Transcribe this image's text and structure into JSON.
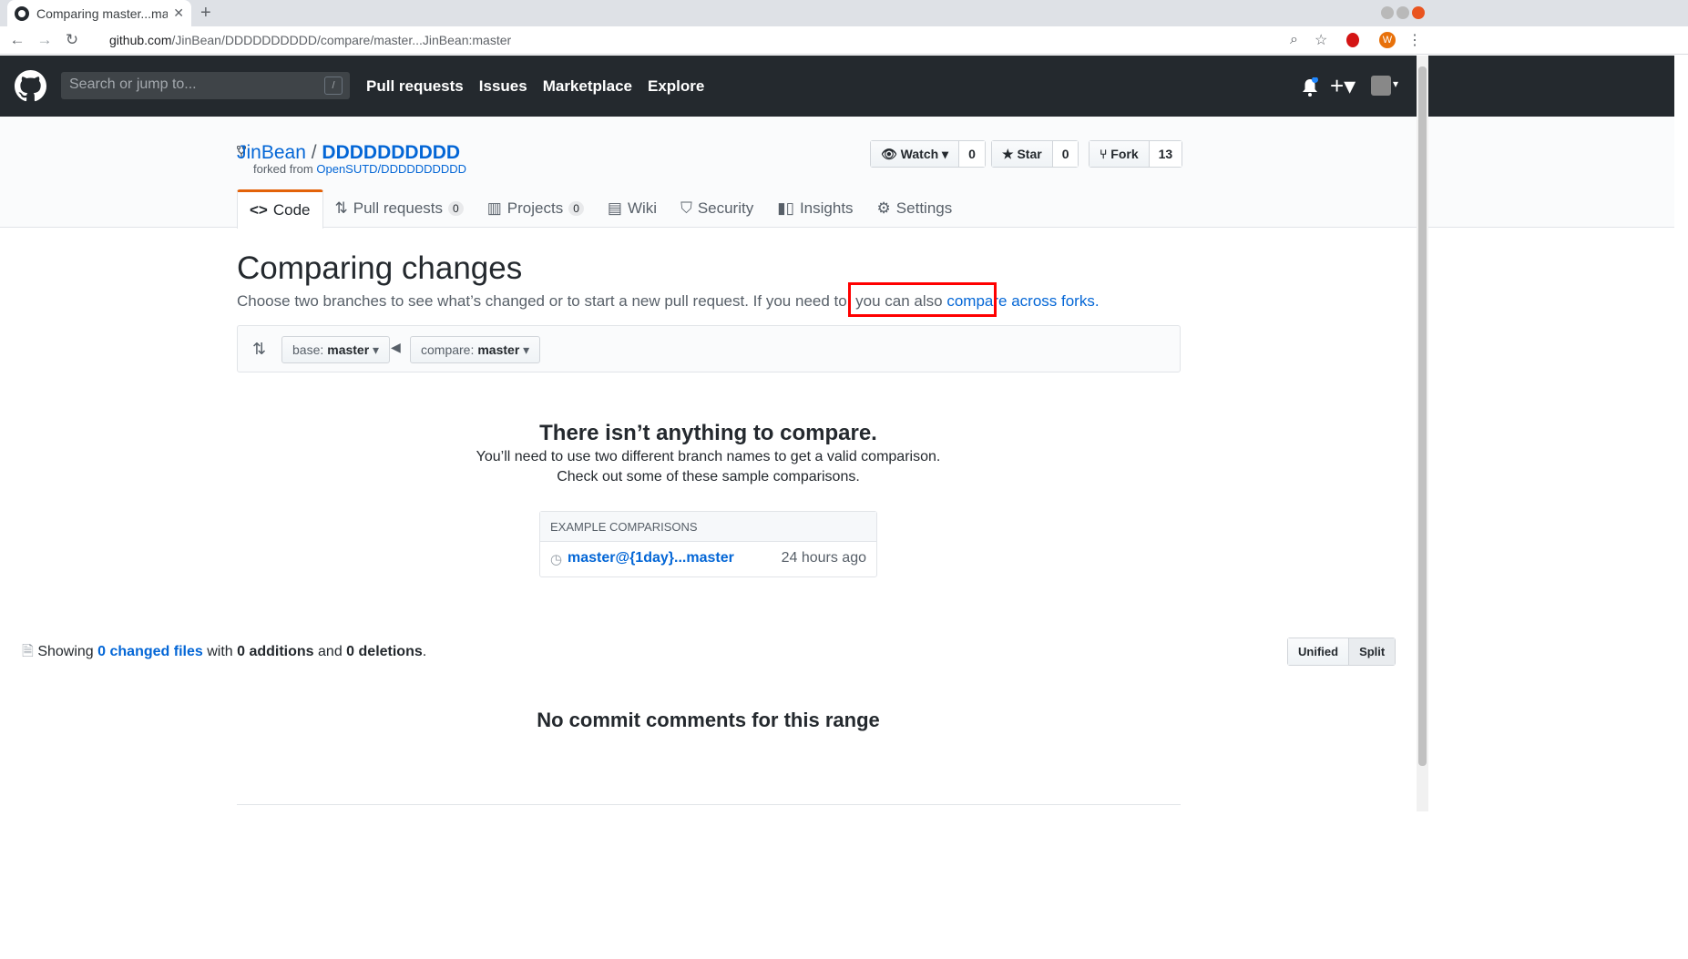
{
  "browser": {
    "tab_title": "Comparing master...mast",
    "url_host": "github.com",
    "url_path": "/JinBean/DDDDDDDDDD/compare/master...JinBean:master",
    "profile_initial": "W"
  },
  "header": {
    "search_placeholder": "Search or jump to...",
    "search_key": "/",
    "nav": [
      "Pull requests",
      "Issues",
      "Marketplace",
      "Explore"
    ]
  },
  "repo": {
    "owner": "JinBean",
    "separator": "/",
    "name": "DDDDDDDDDD",
    "forked_prefix": "forked from",
    "forked_from": "OpenSUTD/DDDDDDDDDD",
    "watch_label": "Watch",
    "watch_count": "0",
    "star_label": "Star",
    "star_count": "0",
    "fork_label": "Fork",
    "fork_count": "13"
  },
  "tabs": {
    "code": "Code",
    "pulls": "Pull requests",
    "pulls_count": "0",
    "projects": "Projects",
    "projects_count": "0",
    "wiki": "Wiki",
    "security": "Security",
    "insights": "Insights",
    "settings": "Settings"
  },
  "compare": {
    "title": "Comparing changes",
    "subtitle": "Choose two branches to see what’s changed or to start a new pull request. If you need to, you can also",
    "forks_link": "compare across forks.",
    "base_label": "base:",
    "base_value": "master",
    "compare_label": "compare:",
    "compare_value": "master"
  },
  "blankslate": {
    "title": "There isn’t anything to compare.",
    "line1": "You’ll need to use two different branch names to get a valid comparison.",
    "line2": "Check out some of these sample comparisons."
  },
  "examples": {
    "header": "EXAMPLE COMPARISONS",
    "item_link": "master@{1day}...master",
    "item_time": "24 hours ago"
  },
  "summary": {
    "showing": "Showing",
    "files_link": "0 changed files",
    "with": "with",
    "additions": "0 additions",
    "and": "and",
    "deletions": "0 deletions",
    "end": "."
  },
  "diff_view": {
    "unified": "Unified",
    "split": "Split"
  },
  "comments": {
    "empty": "No commit comments for this range"
  },
  "colors": {
    "header_bg": "#24292e",
    "link": "#0366d6",
    "highlight_box": "#ff0000",
    "active_tab_accent": "#e36209"
  }
}
